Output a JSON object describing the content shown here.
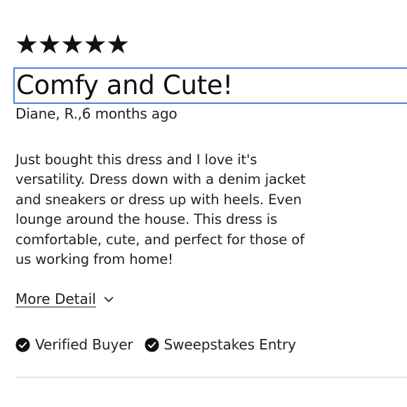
{
  "review": {
    "rating_stars": [
      "★",
      "★",
      "★",
      "★",
      "★"
    ],
    "rating_value": 5,
    "title": "Comfy and Cute!",
    "byline": "Diane, R.,6 months ago",
    "body": "Just bought this dress and I love it's versatility. Dress down with a denim jacket and sneakers or dress up with heels. Even lounge around the house. This dress is comfortable, cute, and perfect for those of us working from home!",
    "more_detail_label": "More Detail",
    "badges": [
      {
        "label": "Verified Buyer",
        "icon": "check-circle-icon"
      },
      {
        "label": "Sweepstakes Entry",
        "icon": "check-circle-icon"
      }
    ]
  },
  "colors": {
    "focus_outline": "#4a86d9",
    "text": "#222222",
    "divider": "#cfcfcf"
  }
}
